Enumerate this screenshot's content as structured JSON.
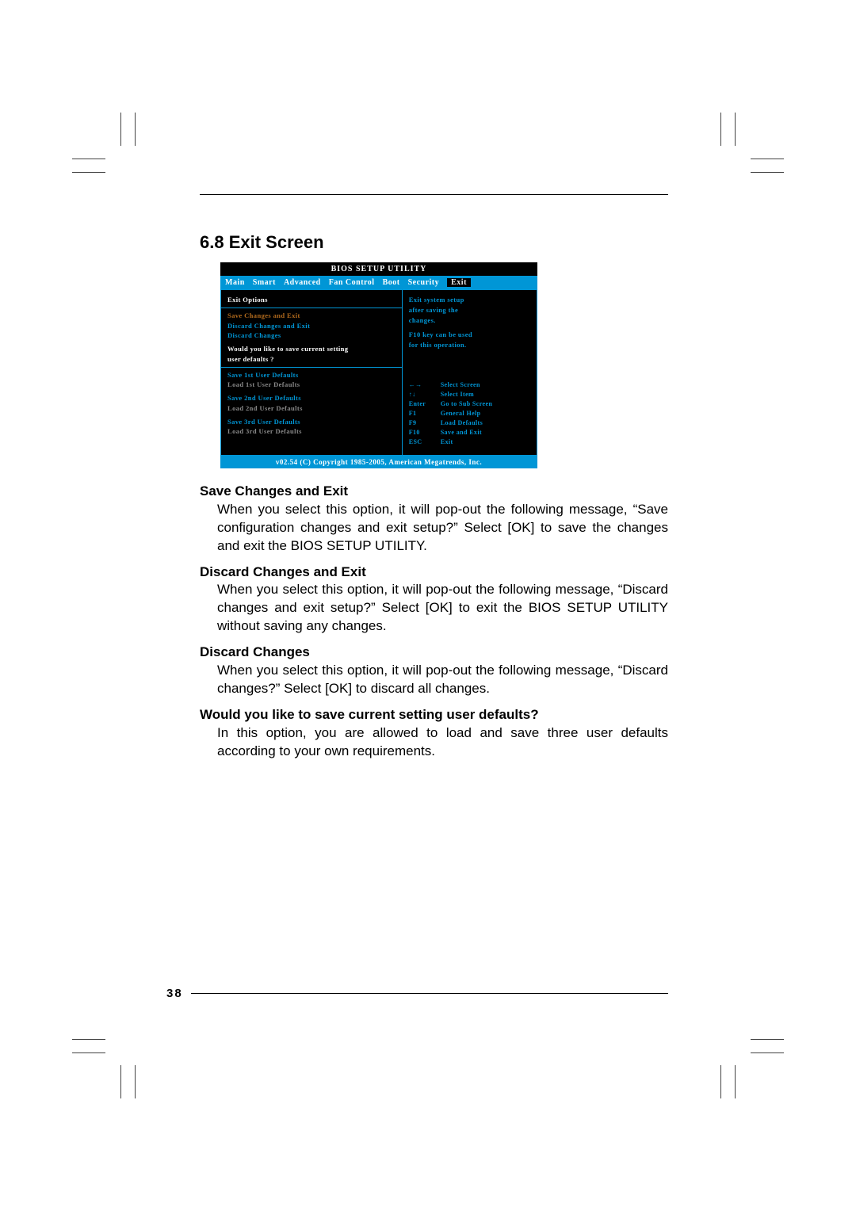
{
  "section": {
    "number": "6.8",
    "title": "Exit Screen"
  },
  "bios": {
    "title": "BIOS SETUP UTILITY",
    "tabs": [
      "Main",
      "Smart",
      "Advanced",
      "Fan Control",
      "Boot",
      "Security"
    ],
    "active_tab": "Exit",
    "left": {
      "heading": "Exit Options",
      "items1": [
        "Save Changes and Exit",
        "Discard Changes and Exit",
        "Discard Changes"
      ],
      "prompt_line1": "Would you like to save current setting",
      "prompt_line2": "user defaults ?",
      "user_defaults": [
        {
          "save": "Save 1st User Defaults",
          "load": "Load 1st User Defaults"
        },
        {
          "save": "Save 2nd User Defaults",
          "load": "Load 2nd User Defaults"
        },
        {
          "save": "Save 3rd User Defaults",
          "load": "Load 3rd User Defaults"
        }
      ]
    },
    "right": {
      "msg1": "Exit system setup",
      "msg2": "after saving the",
      "msg3": "changes.",
      "msg4": "F10 key can be used",
      "msg5": "for this operation.",
      "keys": [
        {
          "k": "←→",
          "v": "Select Screen"
        },
        {
          "k": "↑↓",
          "v": "Select Item"
        },
        {
          "k": "Enter",
          "v": "Go to Sub Screen"
        },
        {
          "k": "F1",
          "v": "General Help"
        },
        {
          "k": "F9",
          "v": "Load Defaults"
        },
        {
          "k": "F10",
          "v": "Save and Exit"
        },
        {
          "k": "ESC",
          "v": "Exit"
        }
      ]
    },
    "footer": "v02.54 (C) Copyright 1985-2005, American Megatrends, Inc."
  },
  "explanations": [
    {
      "title": "Save Changes and Exit",
      "desc": "When you select this option, it will pop-out the following message, “Save configuration changes and exit setup?” Select [OK] to save the changes and exit the BIOS SETUP UTILITY."
    },
    {
      "title": "Discard Changes and Exit",
      "desc": "When you select this option, it will pop-out the following message, “Discard changes and exit setup?” Select [OK] to exit the BIOS SETUP UTILITY without saving any changes."
    },
    {
      "title": "Discard Changes",
      "desc": "When you select this option, it will pop-out the following message, “Discard changes?” Select [OK] to discard all changes."
    },
    {
      "title": "Would you like to save current setting user defaults?",
      "desc": "In this option, you are allowed to load and save three user defaults according to your own requirements."
    }
  ],
  "page_number": "38"
}
